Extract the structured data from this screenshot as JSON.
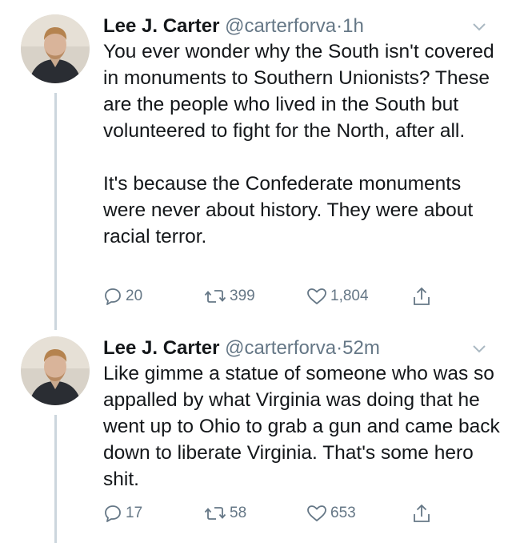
{
  "tweets": [
    {
      "name": "Lee J. Carter",
      "handle": "@carterforva",
      "separator": "·",
      "time": "1h",
      "text_p1": "You ever wonder why the South isn't covered in monuments to Southern Unionists? These are the people who lived in the South but volunteered to fight for the North, after all.",
      "text_p2": "It's because the Confederate monuments were never about history.  They were about racial terror.",
      "replies": "20",
      "retweets": "399",
      "likes": "1,804"
    },
    {
      "name": "Lee J. Carter",
      "handle": "@carterforva",
      "separator": "·",
      "time": "52m",
      "text_p1": "Like gimme a statue of someone who was so appalled by what Virginia was doing that he went up to Ohio to grab a gun and came back down to liberate Virginia.  That's some hero shit.",
      "replies": "17",
      "retweets": "58",
      "likes": "653"
    }
  ],
  "icons": {
    "reply": "reply-icon",
    "retweet": "retweet-icon",
    "like": "heart-icon",
    "share": "share-icon",
    "menu": "chevron-down-icon"
  },
  "colors": {
    "text": "#14171a",
    "secondary": "#657786",
    "thread_line": "#ccd6dd"
  }
}
